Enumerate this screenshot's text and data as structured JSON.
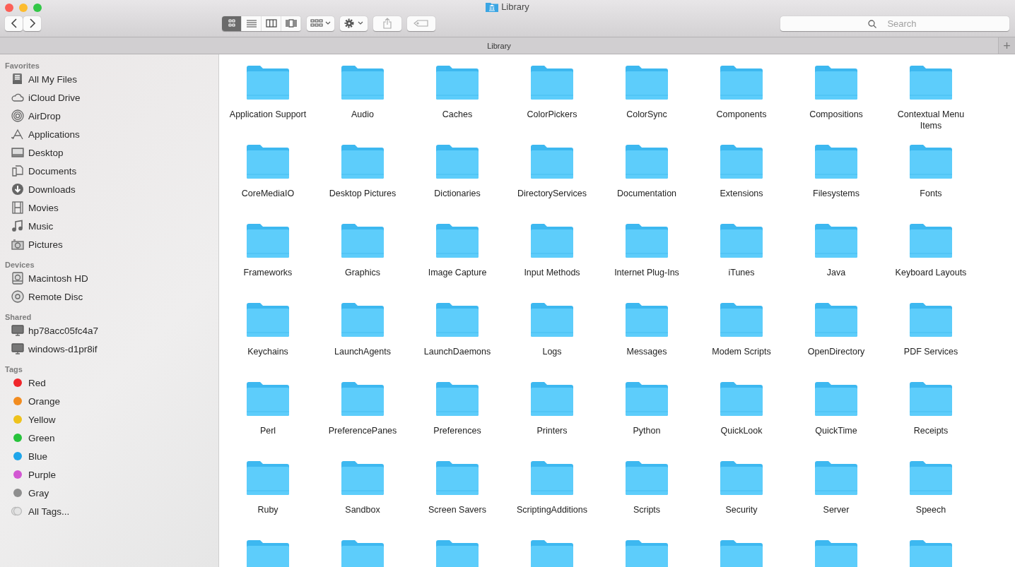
{
  "window": {
    "title": "Library"
  },
  "toolbar": {
    "view_modes": [
      {
        "selected": true
      },
      {
        "selected": false
      },
      {
        "selected": false
      },
      {
        "selected": false
      }
    ],
    "search": {
      "placeholder": "Search"
    }
  },
  "path_tab": {
    "label": "Library",
    "add": "+"
  },
  "sidebar": [
    {
      "heading": "Favorites",
      "items": [
        {
          "label": "All My Files"
        },
        {
          "label": "iCloud Drive"
        },
        {
          "label": "AirDrop"
        },
        {
          "label": "Applications"
        },
        {
          "label": "Desktop"
        },
        {
          "label": "Documents"
        },
        {
          "label": "Downloads"
        },
        {
          "label": "Movies"
        },
        {
          "label": "Music"
        },
        {
          "label": "Pictures"
        }
      ]
    },
    {
      "heading": "Devices",
      "items": [
        {
          "label": "Macintosh HD"
        },
        {
          "label": "Remote Disc"
        }
      ]
    },
    {
      "heading": "Shared",
      "items": [
        {
          "label": "hp78acc05fc4a7"
        },
        {
          "label": "windows-d1pr8if"
        }
      ]
    },
    {
      "heading": "Tags",
      "items": [
        {
          "label": "Red",
          "color": "#f0262b"
        },
        {
          "label": "Orange",
          "color": "#f28c1f"
        },
        {
          "label": "Yellow",
          "color": "#eec21c"
        },
        {
          "label": "Green",
          "color": "#27c33b"
        },
        {
          "label": "Blue",
          "color": "#1ea5ea"
        },
        {
          "label": "Purple",
          "color": "#d257d2"
        },
        {
          "label": "Gray",
          "color": "#8e8e8e"
        },
        {
          "label": "All Tags..."
        }
      ]
    }
  ],
  "folders": [
    {
      "name": "Application Support",
      "selected": false
    },
    {
      "name": "Audio",
      "selected": false
    },
    {
      "name": "Caches",
      "selected": false
    },
    {
      "name": "ColorPickers",
      "selected": false
    },
    {
      "name": "ColorSync",
      "selected": false
    },
    {
      "name": "Components",
      "selected": false
    },
    {
      "name": "Compositions",
      "selected": false
    },
    {
      "name": "Contextual Menu Items",
      "selected": false
    },
    {
      "name": "CoreMediaIO",
      "selected": false
    },
    {
      "name": "Desktop Pictures",
      "selected": false
    },
    {
      "name": "Dictionaries",
      "selected": false
    },
    {
      "name": "DirectoryServices",
      "selected": false
    },
    {
      "name": "Documentation",
      "selected": false
    },
    {
      "name": "Extensions",
      "selected": false
    },
    {
      "name": "Filesystems",
      "selected": false
    },
    {
      "name": "Fonts",
      "selected": false
    },
    {
      "name": "Frameworks",
      "selected": false
    },
    {
      "name": "Graphics",
      "selected": false
    },
    {
      "name": "Image Capture",
      "selected": false
    },
    {
      "name": "Input Methods",
      "selected": false
    },
    {
      "name": "Internet Plug-Ins",
      "selected": false
    },
    {
      "name": "iTunes",
      "selected": false
    },
    {
      "name": "Java",
      "selected": false
    },
    {
      "name": "Keyboard Layouts",
      "selected": false
    },
    {
      "name": "Keychains",
      "selected": false
    },
    {
      "name": "LaunchAgents",
      "selected": false
    },
    {
      "name": "LaunchDaemons",
      "selected": false
    },
    {
      "name": "Logs",
      "selected": false
    },
    {
      "name": "Messages",
      "selected": false
    },
    {
      "name": "Modem Scripts",
      "selected": false
    },
    {
      "name": "OpenDirectory",
      "selected": false
    },
    {
      "name": "PDF Services",
      "selected": false
    },
    {
      "name": "Perl",
      "selected": false
    },
    {
      "name": "PreferencePanes",
      "selected": false
    },
    {
      "name": "Preferences",
      "selected": false
    },
    {
      "name": "Printers",
      "selected": false
    },
    {
      "name": "Python",
      "selected": false
    },
    {
      "name": "QuickLook",
      "selected": false
    },
    {
      "name": "QuickTime",
      "selected": false
    },
    {
      "name": "Receipts",
      "selected": false
    },
    {
      "name": "Ruby",
      "selected": false
    },
    {
      "name": "Sandbox",
      "selected": false
    },
    {
      "name": "Screen Savers",
      "selected": false
    },
    {
      "name": "ScriptingAdditions",
      "selected": false
    },
    {
      "name": "Scripts",
      "selected": false
    },
    {
      "name": "Security",
      "selected": false
    },
    {
      "name": "Server",
      "selected": false
    },
    {
      "name": "Speech",
      "selected": false
    },
    {
      "selected": false
    },
    {
      "selected": false
    },
    {
      "selected": false
    },
    {
      "selected": false
    },
    {
      "selected": false
    },
    {
      "selected": false
    },
    {
      "selected": false
    },
    {
      "selected": false
    }
  ]
}
